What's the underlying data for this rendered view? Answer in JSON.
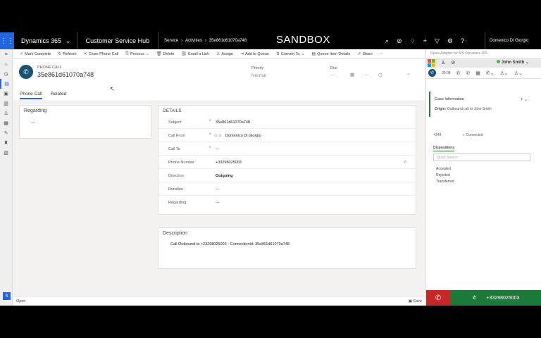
{
  "topbar": {
    "brand": "Dynamics 365",
    "app": "Customer Service Hub",
    "breadcrumb": [
      "Service",
      "Activities",
      "35e861d61070a748"
    ],
    "environment": "SANDBOX",
    "user": "Domenico Di Giorgio"
  },
  "commands": [
    {
      "icon": "check-icon",
      "label": "Mark Complete"
    },
    {
      "icon": "refresh-icon",
      "label": "Refresh"
    },
    {
      "icon": "close-icon",
      "label": "Close Phone Call"
    },
    {
      "icon": "process-icon",
      "label": "Process"
    },
    {
      "icon": "delete-icon",
      "label": "Delete"
    },
    {
      "icon": "link-icon",
      "label": "Email a Link"
    },
    {
      "icon": "assign-icon",
      "label": "Assign"
    },
    {
      "icon": "queue-icon",
      "label": "Add to Queue"
    },
    {
      "icon": "convert-icon",
      "label": "Convert To"
    },
    {
      "icon": "queue-details-icon",
      "label": "Queue Item Details"
    },
    {
      "icon": "share-icon",
      "label": "Share"
    }
  ],
  "record": {
    "entity_type": "PHONE CALL",
    "name": "35e861d61070a748",
    "priority_label": "Priority",
    "priority_value": "Normal",
    "due_label": "Due",
    "due_value": "---"
  },
  "tabs": [
    "Phone Call",
    "Related"
  ],
  "regarding_card": {
    "title": "Regarding",
    "value": "---"
  },
  "details": {
    "title": "DETAILS",
    "fields": [
      {
        "label": "Subject",
        "required": true,
        "value": "35e861d61070a748"
      },
      {
        "label": "Call From",
        "required": true,
        "value": "Domenico Di Giorgio"
      },
      {
        "label": "Call To",
        "required": true,
        "value": "---"
      },
      {
        "label": "Phone Number",
        "required": false,
        "value": "+33298025003"
      },
      {
        "label": "Direction",
        "required": false,
        "value": "Outgoing"
      },
      {
        "label": "Duration",
        "required": false,
        "value": "---"
      },
      {
        "label": "Regarding",
        "required": false,
        "value": "---"
      }
    ]
  },
  "description": {
    "title": "Description",
    "text": "Call Outbound to +33298025003 - ConnectionId: 35e861d61070a748"
  },
  "statusbar": {
    "left": "Open",
    "right": "Save"
  },
  "panel": {
    "title": "Gplus Adapter for MS Dynamics 365",
    "agent": "John Smith",
    "timer": "00:08",
    "case_title": "Case Information",
    "origin_label": "Origin:",
    "origin_value": "Outbound call to John Smith",
    "caller_number": "+349",
    "call_status": "Connected",
    "dispositions_label": "Dispositions",
    "search_placeholder": "Quick Search",
    "dispositions": [
      "Accepted",
      "Rejected",
      "Transferred"
    ],
    "dial_number": "+33298025003"
  },
  "colors": {
    "accent": "#2266e3",
    "hangup": "#c62828",
    "call_green": "#1b7a3a"
  }
}
